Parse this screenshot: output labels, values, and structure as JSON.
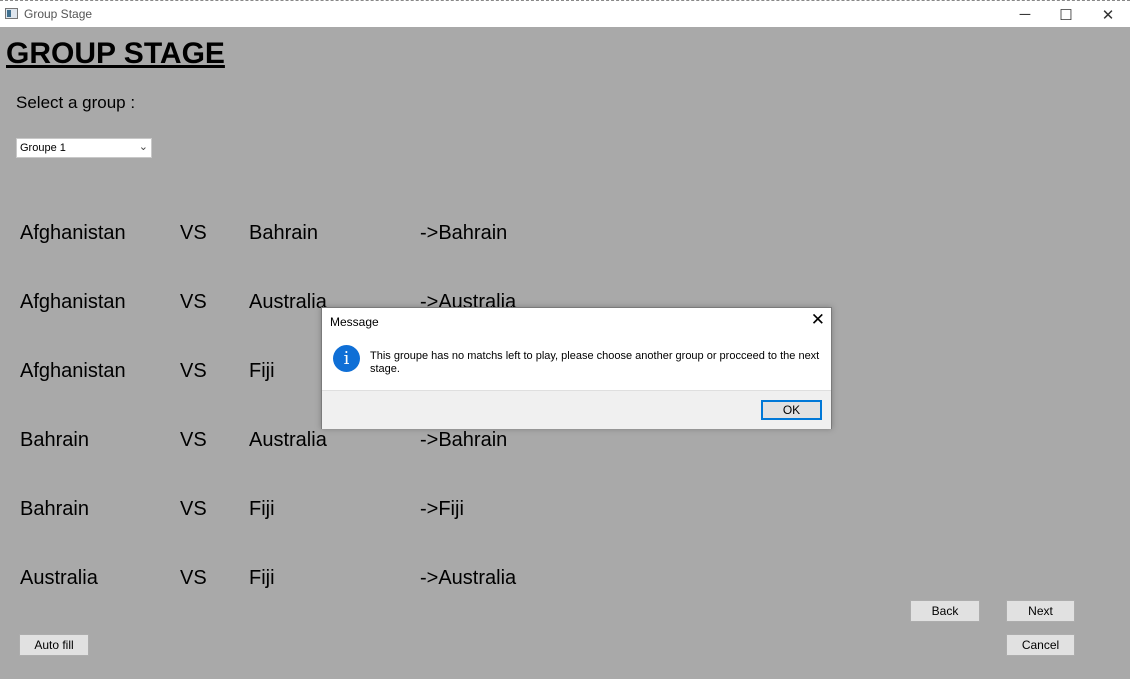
{
  "window": {
    "title": "Group Stage",
    "minimize_glyph": "─",
    "maximize_glyph": "☐",
    "close_glyph": "✕"
  },
  "page": {
    "heading": "GROUP STAGE",
    "select_label": "Select a group :"
  },
  "group_select": {
    "value": "Groupe 1",
    "chevron": "⌄"
  },
  "matches": [
    {
      "team1": "Afghanistan",
      "vs": "VS",
      "team2": "Bahrain",
      "winner": "->Bahrain"
    },
    {
      "team1": "Afghanistan",
      "vs": "VS",
      "team2": "Australia",
      "winner": "->Australia"
    },
    {
      "team1": "Afghanistan",
      "vs": "VS",
      "team2": "Fiji",
      "winner": ""
    },
    {
      "team1": "Bahrain",
      "vs": "VS",
      "team2": "Australia",
      "winner": "->Bahrain"
    },
    {
      "team1": "Bahrain",
      "vs": "VS",
      "team2": "Fiji",
      "winner": "->Fiji"
    },
    {
      "team1": "Australia",
      "vs": "VS",
      "team2": "Fiji",
      "winner": "->Australia"
    }
  ],
  "buttons": {
    "back": "Back",
    "next": "Next",
    "cancel": "Cancel",
    "auto_fill": "Auto fill"
  },
  "dialog": {
    "title": "Message",
    "close_glyph": "✕",
    "icon": "info-icon",
    "icon_glyph": "i",
    "message": "This groupe has no matchs left to play, please choose another group or procceed to the next stage.",
    "ok_label": "OK"
  },
  "colors": {
    "background": "#a9a9a9",
    "info_icon": "#0f6fd6",
    "ok_border": "#0078d7"
  }
}
